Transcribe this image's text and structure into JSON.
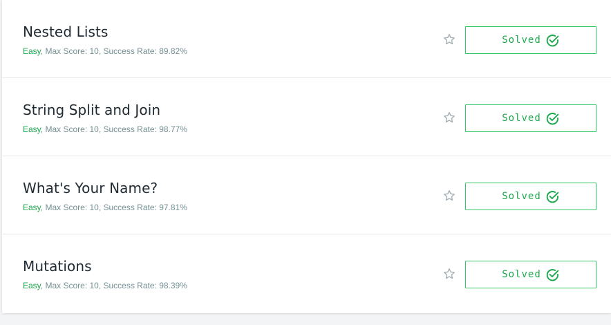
{
  "colors": {
    "accent": "#1ba94c",
    "button_border": "#2ec866",
    "title": "#1f2a33",
    "meta": "#738f93"
  },
  "challenges": [
    {
      "title": "Nested Lists",
      "difficulty": "Easy",
      "meta_suffix": ", Max Score: 10, Success Rate: 89.82%",
      "status": "Solved",
      "icon": "check-circle-icon"
    },
    {
      "title": "String Split and Join",
      "difficulty": "Easy",
      "meta_suffix": ", Max Score: 10, Success Rate: 98.77%",
      "status": "Solved",
      "icon": "check-circle-icon"
    },
    {
      "title": "What's Your Name?",
      "difficulty": "Easy",
      "meta_suffix": ", Max Score: 10, Success Rate: 97.81%",
      "status": "Solved",
      "icon": "check-circle-icon"
    },
    {
      "title": "Mutations",
      "difficulty": "Easy",
      "meta_suffix": ", Max Score: 10, Success Rate: 98.39%",
      "status": "Solved",
      "icon": "check-circle-icon"
    }
  ]
}
